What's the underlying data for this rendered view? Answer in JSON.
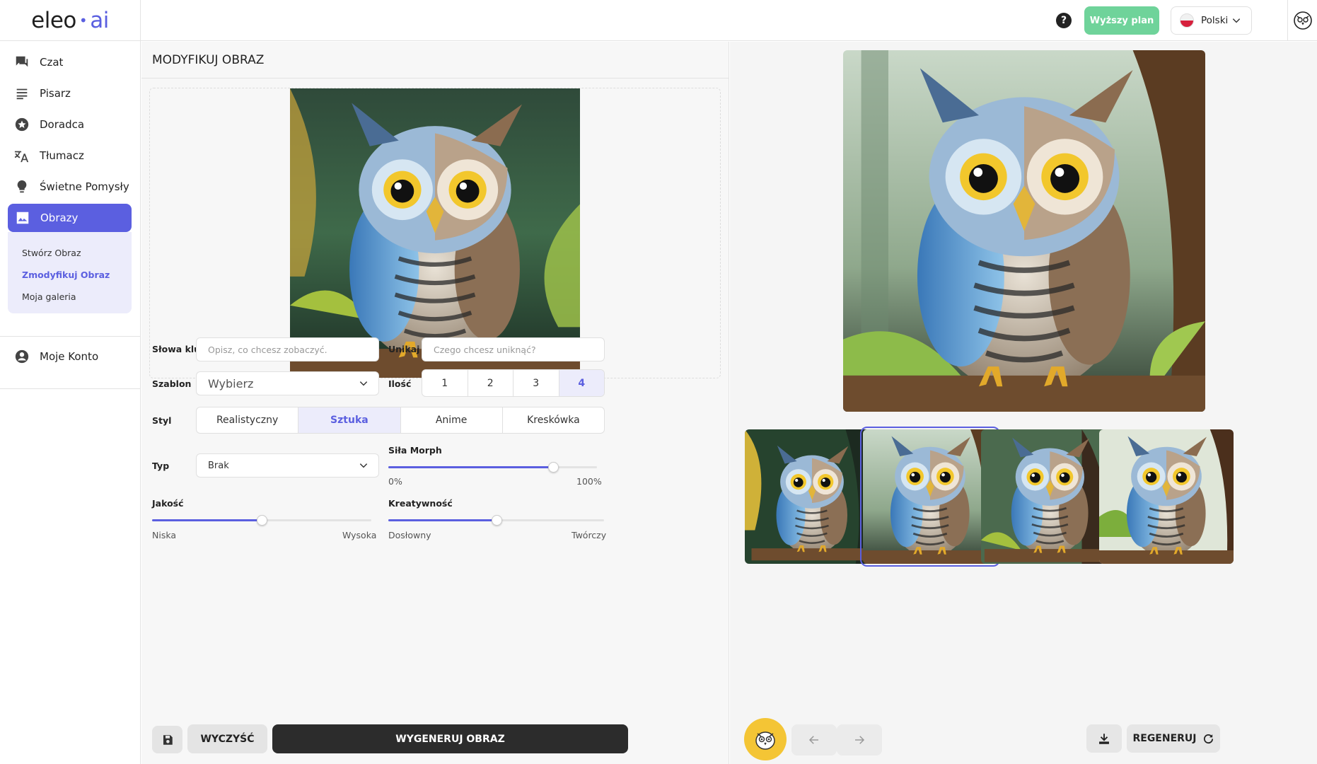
{
  "app": {
    "logo_main": "eleo",
    "logo_ai": "ai"
  },
  "sidebar": {
    "items": [
      {
        "label": "Czat",
        "icon": "chat-icon"
      },
      {
        "label": "Pisarz",
        "icon": "lines-icon"
      },
      {
        "label": "Doradca",
        "icon": "star-icon"
      },
      {
        "label": "Tłumacz",
        "icon": "translate-icon"
      },
      {
        "label": "Świetne Pomysły",
        "icon": "lightbulb-icon"
      },
      {
        "label": "Obrazy",
        "icon": "image-icon"
      }
    ],
    "subitems": [
      {
        "label": "Stwórz Obraz"
      },
      {
        "label": "Zmodyfikuj Obraz"
      },
      {
        "label": "Moja galeria"
      }
    ],
    "account_label": "Moje Konto"
  },
  "topbar": {
    "help": "?",
    "upgrade_label": "Wyższy plan",
    "language": "Polski"
  },
  "editor": {
    "title": "MODYFIKUJ OBRAZ",
    "keywords_label": "Słowa kluczowe",
    "keywords_placeholder": "Opisz, co chcesz zobaczyć.",
    "avoid_label": "Unikaj",
    "avoid_placeholder": "Czego chcesz uniknąć?",
    "template_label": "Szablon",
    "template_value": "Wybierz",
    "count_label": "Ilość",
    "count_options": [
      "1",
      "2",
      "3",
      "4"
    ],
    "count_selected": "4",
    "style_label": "Styl",
    "style_options": [
      "Realistyczny",
      "Sztuka",
      "Anime",
      "Kreskówka"
    ],
    "style_selected": "Sztuka",
    "type_label": "Typ",
    "type_value": "Brak",
    "morph_label": "Siła Morph",
    "morph_min": "0%",
    "morph_max": "100%",
    "morph_value": 0.79,
    "quality_label": "Jakość",
    "quality_min": "Niska",
    "quality_max": "Wysoka",
    "quality_value": 0.5,
    "creativity_label": "Kreatywność",
    "creativity_min": "Dosłowny",
    "creativity_max": "Twórczy",
    "creativity_value": 0.5,
    "clear_label": "WYCZYŚĆ",
    "generate_label": "WYGENERUJ OBRAZ"
  },
  "results": {
    "thumbnails": 4,
    "selected_thumbnail": 2,
    "regenerate_label": "REGENERUJ"
  },
  "colors": {
    "accent": "#5b5fe0",
    "upgrade": "#6fd39a",
    "generate": "#2c2c2c",
    "owl_button": "#f4c535"
  }
}
